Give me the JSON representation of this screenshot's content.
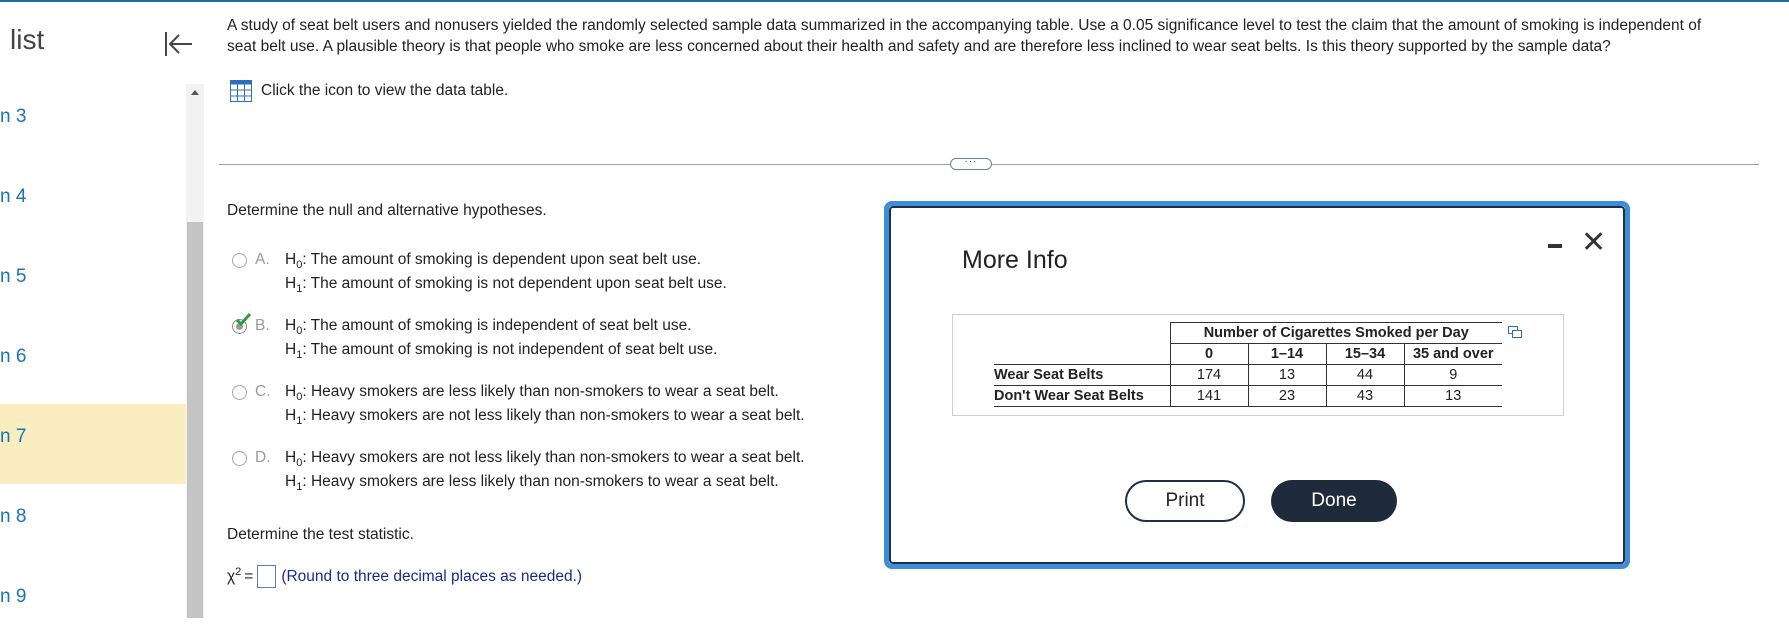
{
  "sidebar": {
    "title": "list",
    "items": [
      {
        "label": "n 3"
      },
      {
        "label": "n 4"
      },
      {
        "label": "n 5"
      },
      {
        "label": "n 6"
      },
      {
        "label": "n 7"
      },
      {
        "label": "n 8"
      },
      {
        "label": "n 9"
      }
    ]
  },
  "question": {
    "text": "A study of seat belt users and nonusers yielded the randomly selected sample data summarized in the accompanying table. Use a 0.05 significance level to test the claim that the amount of smoking is independent of seat belt use. A plausible theory is that people who smoke are less concerned about their health and safety and are therefore less inclined to wear seat belts. Is this theory supported by the sample data?",
    "data_link": "Click the icon to view the data table.",
    "expand_dots": "···"
  },
  "hypotheses": {
    "prompt": "Determine the null and alternative hypotheses.",
    "h0_prefix": "H",
    "h0_sub": "0",
    "h1_prefix": "H",
    "h1_sub": "1",
    "options": [
      {
        "letter": "A.",
        "h0": "The amount of smoking is dependent upon seat belt use.",
        "h1": "The amount of smoking is not dependent upon seat belt use."
      },
      {
        "letter": "B.",
        "h0": "The amount of smoking is independent of seat belt use.",
        "h1": "The amount of smoking is not independent of seat belt use."
      },
      {
        "letter": "C.",
        "h0": "Heavy smokers are less likely than non-smokers to wear a seat belt.",
        "h1": "Heavy smokers are not less likely than non-smokers to wear a seat belt."
      },
      {
        "letter": "D.",
        "h0": "Heavy smokers are not less likely than non-smokers to wear a seat belt.",
        "h1": "Heavy smokers are less likely than non-smokers to wear a seat belt."
      }
    ],
    "selected": "B."
  },
  "test_statistic": {
    "prompt": "Determine the test statistic.",
    "symbol": "χ",
    "exponent": "2",
    "equals": "=",
    "value": "",
    "hint": "(Round to three decimal places as needed.)"
  },
  "modal": {
    "title": "More Info",
    "close_glyph": "✕",
    "table": {
      "group_header": "Number of Cigarettes Smoked per Day",
      "columns": [
        "0",
        "1–14",
        "15–34",
        "35 and over"
      ],
      "rows": [
        {
          "label": "Wear Seat Belts",
          "values": [
            "174",
            "13",
            "44",
            "9"
          ]
        },
        {
          "label": "Don't Wear Seat Belts",
          "values": [
            "141",
            "23",
            "43",
            "13"
          ]
        }
      ]
    },
    "print_label": "Print",
    "done_label": "Done"
  },
  "colors": {
    "accent": "#1c6ea4",
    "modal_border": "#3d8ed8",
    "active_item": "#faedc0",
    "link": "#1a73b8",
    "done_button": "#1f2a3b",
    "check": "#2e9e3c"
  }
}
